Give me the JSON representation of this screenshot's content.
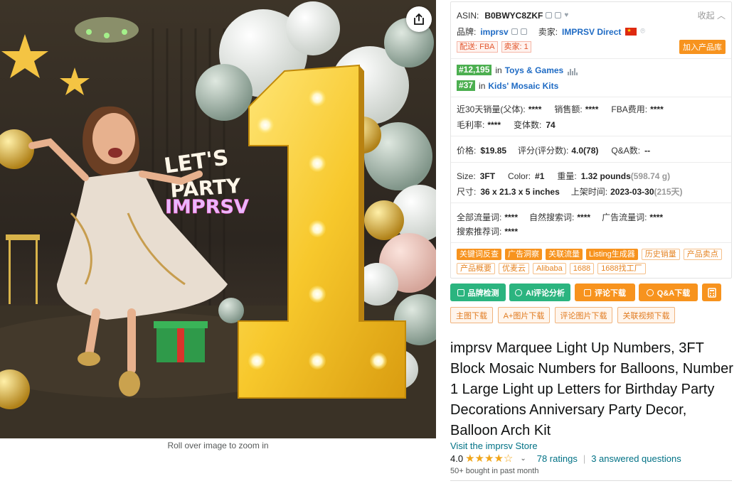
{
  "image": {
    "zoom_hint": "Roll over image to zoom in",
    "sign_text_1": "LET'S",
    "sign_text_2": "PARTY",
    "sign_brand": "IMPRSV",
    "number_glyph": "1"
  },
  "panel": {
    "asin_label": "ASIN:",
    "asin_value": "B0BWYC8ZKF",
    "collapse_label": "收起",
    "brand_label": "品牌:",
    "brand_value": "imprsv",
    "seller_label": "卖家:",
    "seller_value": "IMPRSV Direct",
    "tag_fba": "配送: FBA",
    "tag_sellers": "卖家: 1",
    "add_library": "加入产品库",
    "rank1_badge": "#12,195",
    "rank1_in": "in",
    "rank1_cat": "Toys & Games",
    "rank2_badge": "#37",
    "rank2_in": "in",
    "rank2_cat": "Kids' Mosaic Kits",
    "sales30_label": "近30天销量(父体):",
    "sales30_value": "****",
    "revenue_label": "销售额:",
    "revenue_value": "****",
    "fba_fee_label": "FBA费用:",
    "fba_fee_value": "****",
    "margin_label": "毛利率:",
    "margin_value": "****",
    "variants_label": "变体数:",
    "variants_value": "74",
    "price_label": "价格:",
    "price_value": "$19.85",
    "score_label": "评分(评分数):",
    "score_value": "4.0(78)",
    "qa_label": "Q&A数:",
    "qa_value": "--",
    "size_label": "Size:",
    "size_value": "3FT",
    "color_label": "Color:",
    "color_value": "#1",
    "weight_label": "重量:",
    "weight_value": "1.32 pounds",
    "weight_g": "(598.74 g)",
    "dims_label": "尺寸:",
    "dims_value": "36 x 21.3 x 5 inches",
    "listed_label": "上架时间:",
    "listed_value": "2023-03-30",
    "listed_days": "(215天)",
    "traffic_all_label": "全部流量词:",
    "traffic_all_value": "****",
    "traffic_org_label": "自然搜索词:",
    "traffic_org_value": "****",
    "traffic_ad_label": "广告流量词:",
    "traffic_ad_value": "****",
    "search_rec_label": "搜索推荐词:",
    "search_rec_value": "****",
    "tools_row1": [
      "关键词反查",
      "广告洞察",
      "关联流量",
      "Listing生成器"
    ],
    "tools_row1_outline": [
      "历史销量",
      "产品卖点"
    ],
    "tools_row2": [
      "产品概要",
      "优麦云",
      "Alibaba",
      "1688",
      "1688找工厂"
    ],
    "flag_colors": {
      "red": "#de2910",
      "yellow": "#ffde00"
    }
  },
  "actions": {
    "brand_check": "品牌检测",
    "ai_review": "AI评论分析",
    "review_download": "评论下载",
    "qa_download": "Q&A下载",
    "main_img_dl": "主图下载",
    "aplus_dl": "A+图片下载",
    "review_img_dl": "评论图片下载",
    "video_dl": "关联视频下载",
    "colors": {
      "green": "#2bb47f",
      "orange": "#f7931e"
    }
  },
  "product": {
    "title": "imprsv Marquee Light Up Numbers, 3FT Block Mosaic Numbers for Balloons, Number 1 Large Light up Letters for Birthday Party Decorations Anniversary Party Decor, Balloon Arch Kit",
    "store_link": "Visit the imprsv Store",
    "rating_value": "4.0",
    "stars_filled": 4,
    "ratings_count": "78 ratings",
    "answered": "3 answered questions",
    "bought": "50+ bought in past month"
  }
}
